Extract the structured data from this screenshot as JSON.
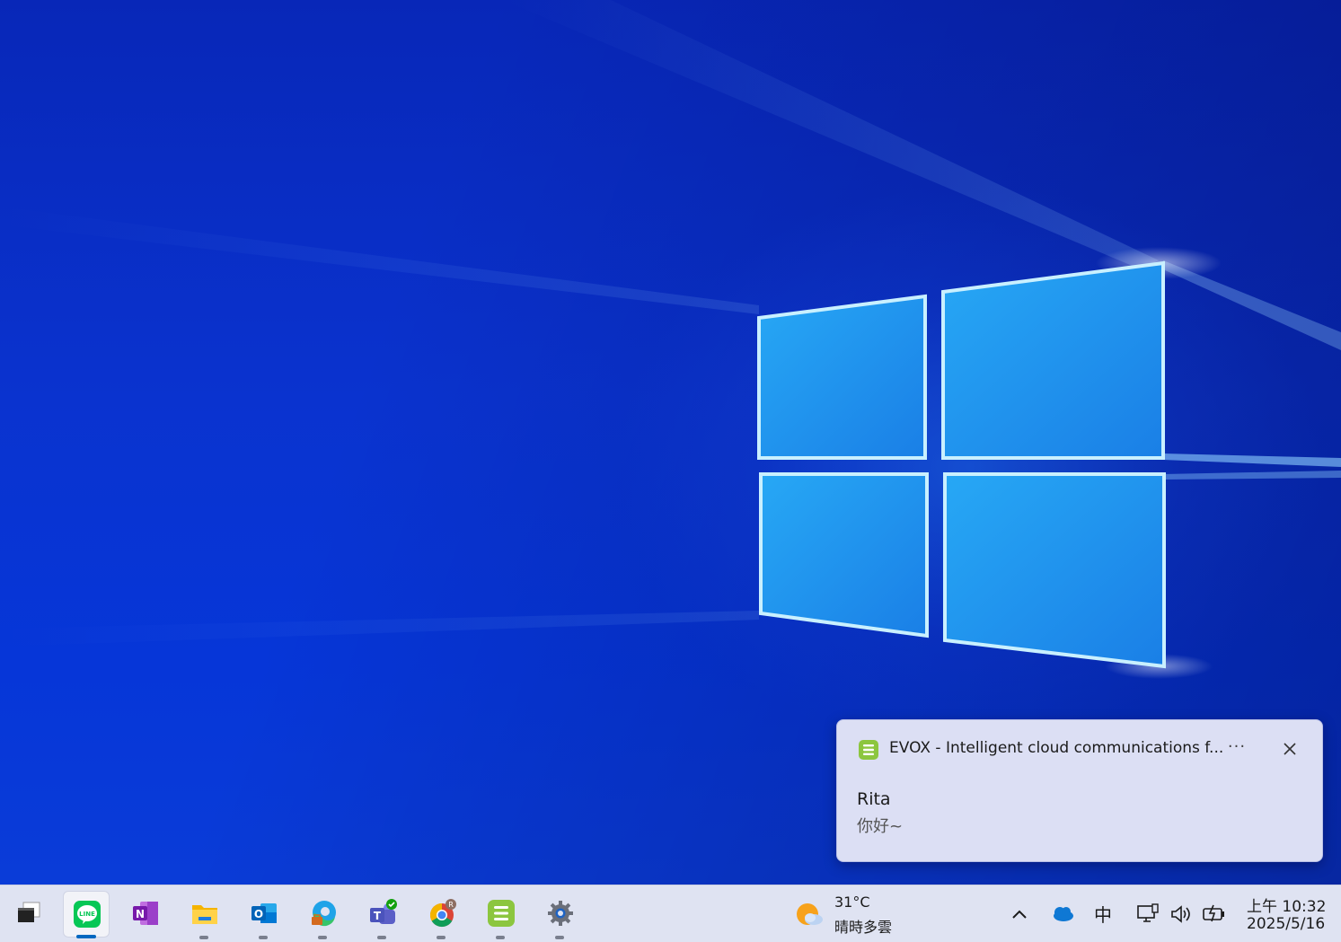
{
  "notification": {
    "app_title": "EVOX - Intelligent cloud communications f...",
    "more_label": "···",
    "sender": "Rita",
    "message": "你好~"
  },
  "taskbar": {
    "apps": [
      {
        "name": "desktop",
        "icon": "show-desktop-icon"
      },
      {
        "name": "LINE",
        "icon": "line-icon",
        "active": true,
        "badge_text": "LINE"
      },
      {
        "name": "OneNote",
        "icon": "onenote-icon",
        "letter": "N"
      },
      {
        "name": "File Explorer",
        "icon": "folder-icon"
      },
      {
        "name": "Outlook",
        "icon": "outlook-icon",
        "letter": "O"
      },
      {
        "name": "Edge",
        "icon": "edge-icon"
      },
      {
        "name": "Teams",
        "icon": "teams-icon",
        "letter": "T"
      },
      {
        "name": "Chrome",
        "icon": "chrome-icon",
        "profile_letter": "R"
      },
      {
        "name": "EVOX",
        "icon": "evox-icon"
      },
      {
        "name": "Settings",
        "icon": "gear-icon"
      }
    ],
    "weather": {
      "temp": "31°C",
      "desc": "晴時多雲"
    },
    "tray": {
      "ime": "中",
      "icons": [
        "chevron-up-icon",
        "onedrive-cloud-icon",
        "network-icon",
        "volume-icon",
        "battery-icon"
      ]
    },
    "clock": {
      "time": "上午 10:32",
      "date": "2025/5/16"
    }
  },
  "colors": {
    "accent": "#0067c0",
    "evox": "#8cc63f",
    "line": "#06c755"
  }
}
